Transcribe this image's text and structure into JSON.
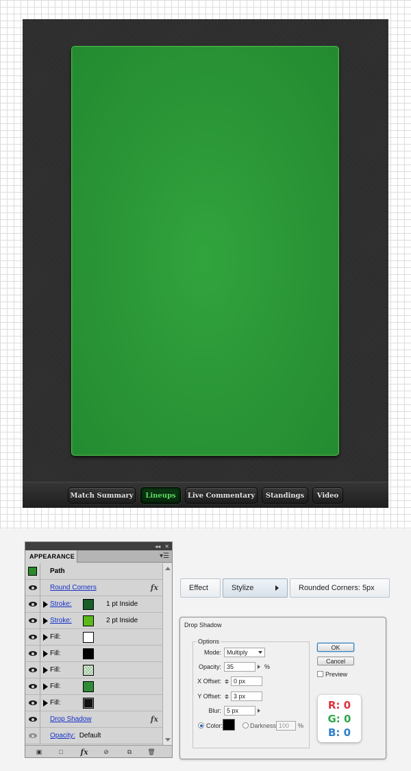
{
  "tabs": [
    {
      "label": "Match Summary",
      "active": false
    },
    {
      "label": "Lineups",
      "active": true
    },
    {
      "label": "Live Commentary",
      "active": false
    },
    {
      "label": "Standings",
      "active": false
    },
    {
      "label": "Video",
      "active": false
    }
  ],
  "appearance": {
    "panel_tab": "APPEARANCE",
    "path_label": "Path",
    "rows": [
      {
        "type": "effect",
        "label": "Round Corners",
        "fx": "fx"
      },
      {
        "type": "stroke",
        "label": "Stroke:",
        "color": "#1a5e2a",
        "value": "1 pt  Inside"
      },
      {
        "type": "stroke",
        "label": "Stroke:",
        "color": "#5db81c",
        "value": "2 pt  Inside"
      },
      {
        "type": "fill",
        "label": "Fill:",
        "color": "#ffffff"
      },
      {
        "type": "fill",
        "label": "Fill:",
        "color": "#000000"
      },
      {
        "type": "fill",
        "label": "Fill:",
        "color": "pattern"
      },
      {
        "type": "fill",
        "label": "Fill:",
        "color": "#2f8b37"
      },
      {
        "type": "fill",
        "label": "Fill:",
        "color": "#111111"
      },
      {
        "type": "effect",
        "label": "Drop Shadow",
        "fx": "fx"
      },
      {
        "type": "opacity",
        "label": "Opacity:",
        "value": "Default"
      }
    ],
    "path_swatch_color": "#2a8a2a"
  },
  "menu_path": {
    "effect": "Effect",
    "stylize": "Stylize",
    "rounded": "Rounded Corners: 5px"
  },
  "drop_shadow": {
    "title": "Drop Shadow",
    "options_label": "Options",
    "mode_label": "Mode:",
    "mode_value": "Multiply",
    "opacity_label": "Opacity:",
    "opacity_value": "35",
    "opacity_unit": "%",
    "x_label": "X Offset:",
    "x_value": "0 px",
    "y_label": "Y Offset:",
    "y_value": "3 px",
    "blur_label": "Blur:",
    "blur_value": "5 px",
    "color_label": "Color:",
    "darkness_label": "Darkness:",
    "darkness_value": "100",
    "darkness_unit": "%",
    "ok": "OK",
    "cancel": "Cancel",
    "preview": "Preview",
    "rgb": {
      "r": "R: 0",
      "g": "G: 0",
      "b": "B: 0"
    }
  },
  "colors": {
    "green_field": "#2b9737",
    "frame": "#2f2f2f",
    "active_tab_text": "#5fe36a",
    "r_color": "#e0303a",
    "g_color": "#2fa84a",
    "b_color": "#2f7fc8"
  }
}
